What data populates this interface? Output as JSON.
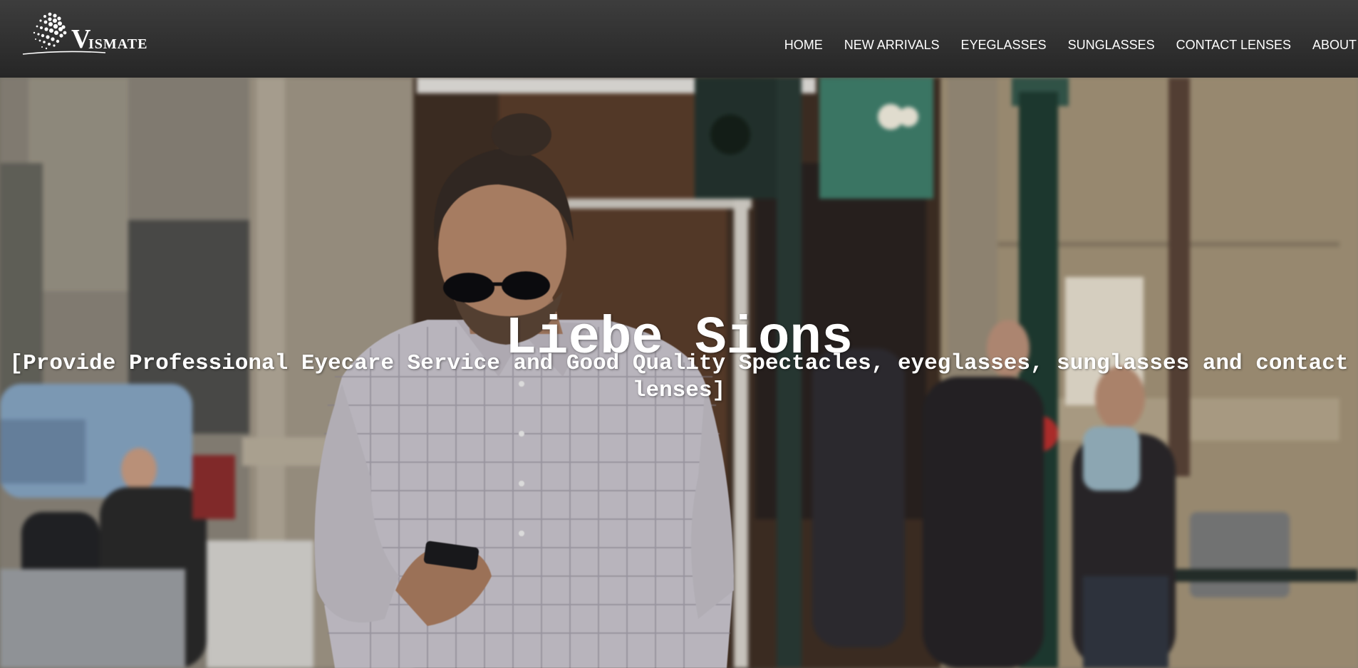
{
  "brand": {
    "logo_letter": "V",
    "logo_rest": "ISMATE"
  },
  "nav": {
    "items": [
      {
        "label": "HOME"
      },
      {
        "label": "NEW ARRIVALS"
      },
      {
        "label": "EYEGLASSES"
      },
      {
        "label": "SUNGLASSES"
      },
      {
        "label": "CONTACT LENSES"
      },
      {
        "label": "ABOUT"
      }
    ]
  },
  "hero": {
    "title": "Liebe Sions",
    "subtitle": "[Provide Professional Eyecare Service and Good Quality Spectacles, eyeglasses, sunglasses and contact lenses]"
  }
}
